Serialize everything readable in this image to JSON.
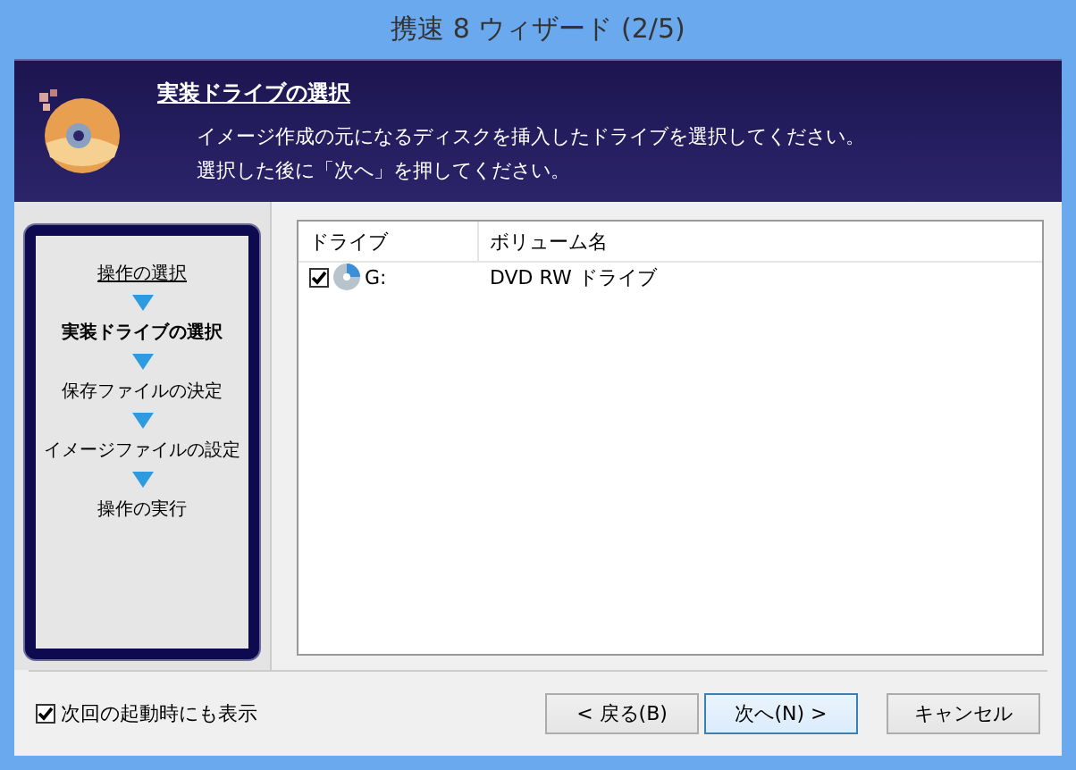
{
  "window": {
    "title": "携速 8 ウィザード (2/5)"
  },
  "header": {
    "title": "実装ドライブの選択",
    "lines": [
      "イメージ作成の元になるディスクを挿入したドライブを選択してください。",
      "選択した後に「次へ」を押してください。"
    ]
  },
  "steps": [
    {
      "label": "操作の選択",
      "kind": "done"
    },
    {
      "label": "実装ドライブの選択",
      "kind": "current"
    },
    {
      "label": "保存ファイルの決定",
      "kind": "pending"
    },
    {
      "label": "イメージファイルの設定",
      "kind": "pending"
    },
    {
      "label": "操作の実行",
      "kind": "pending"
    }
  ],
  "table": {
    "columns": [
      "ドライブ",
      "ボリューム名"
    ],
    "rows": [
      {
        "drive": "G:",
        "volume": "DVD RW ドライブ",
        "checked": true
      }
    ]
  },
  "footer": {
    "show_next_time": {
      "label": "次回の起動時にも表示",
      "checked": true
    },
    "buttons": [
      {
        "label": "< 戻る(B)",
        "default": false
      },
      {
        "label": "次へ(N) >",
        "default": true
      },
      {
        "label": "キャンセル",
        "default": false
      }
    ]
  }
}
